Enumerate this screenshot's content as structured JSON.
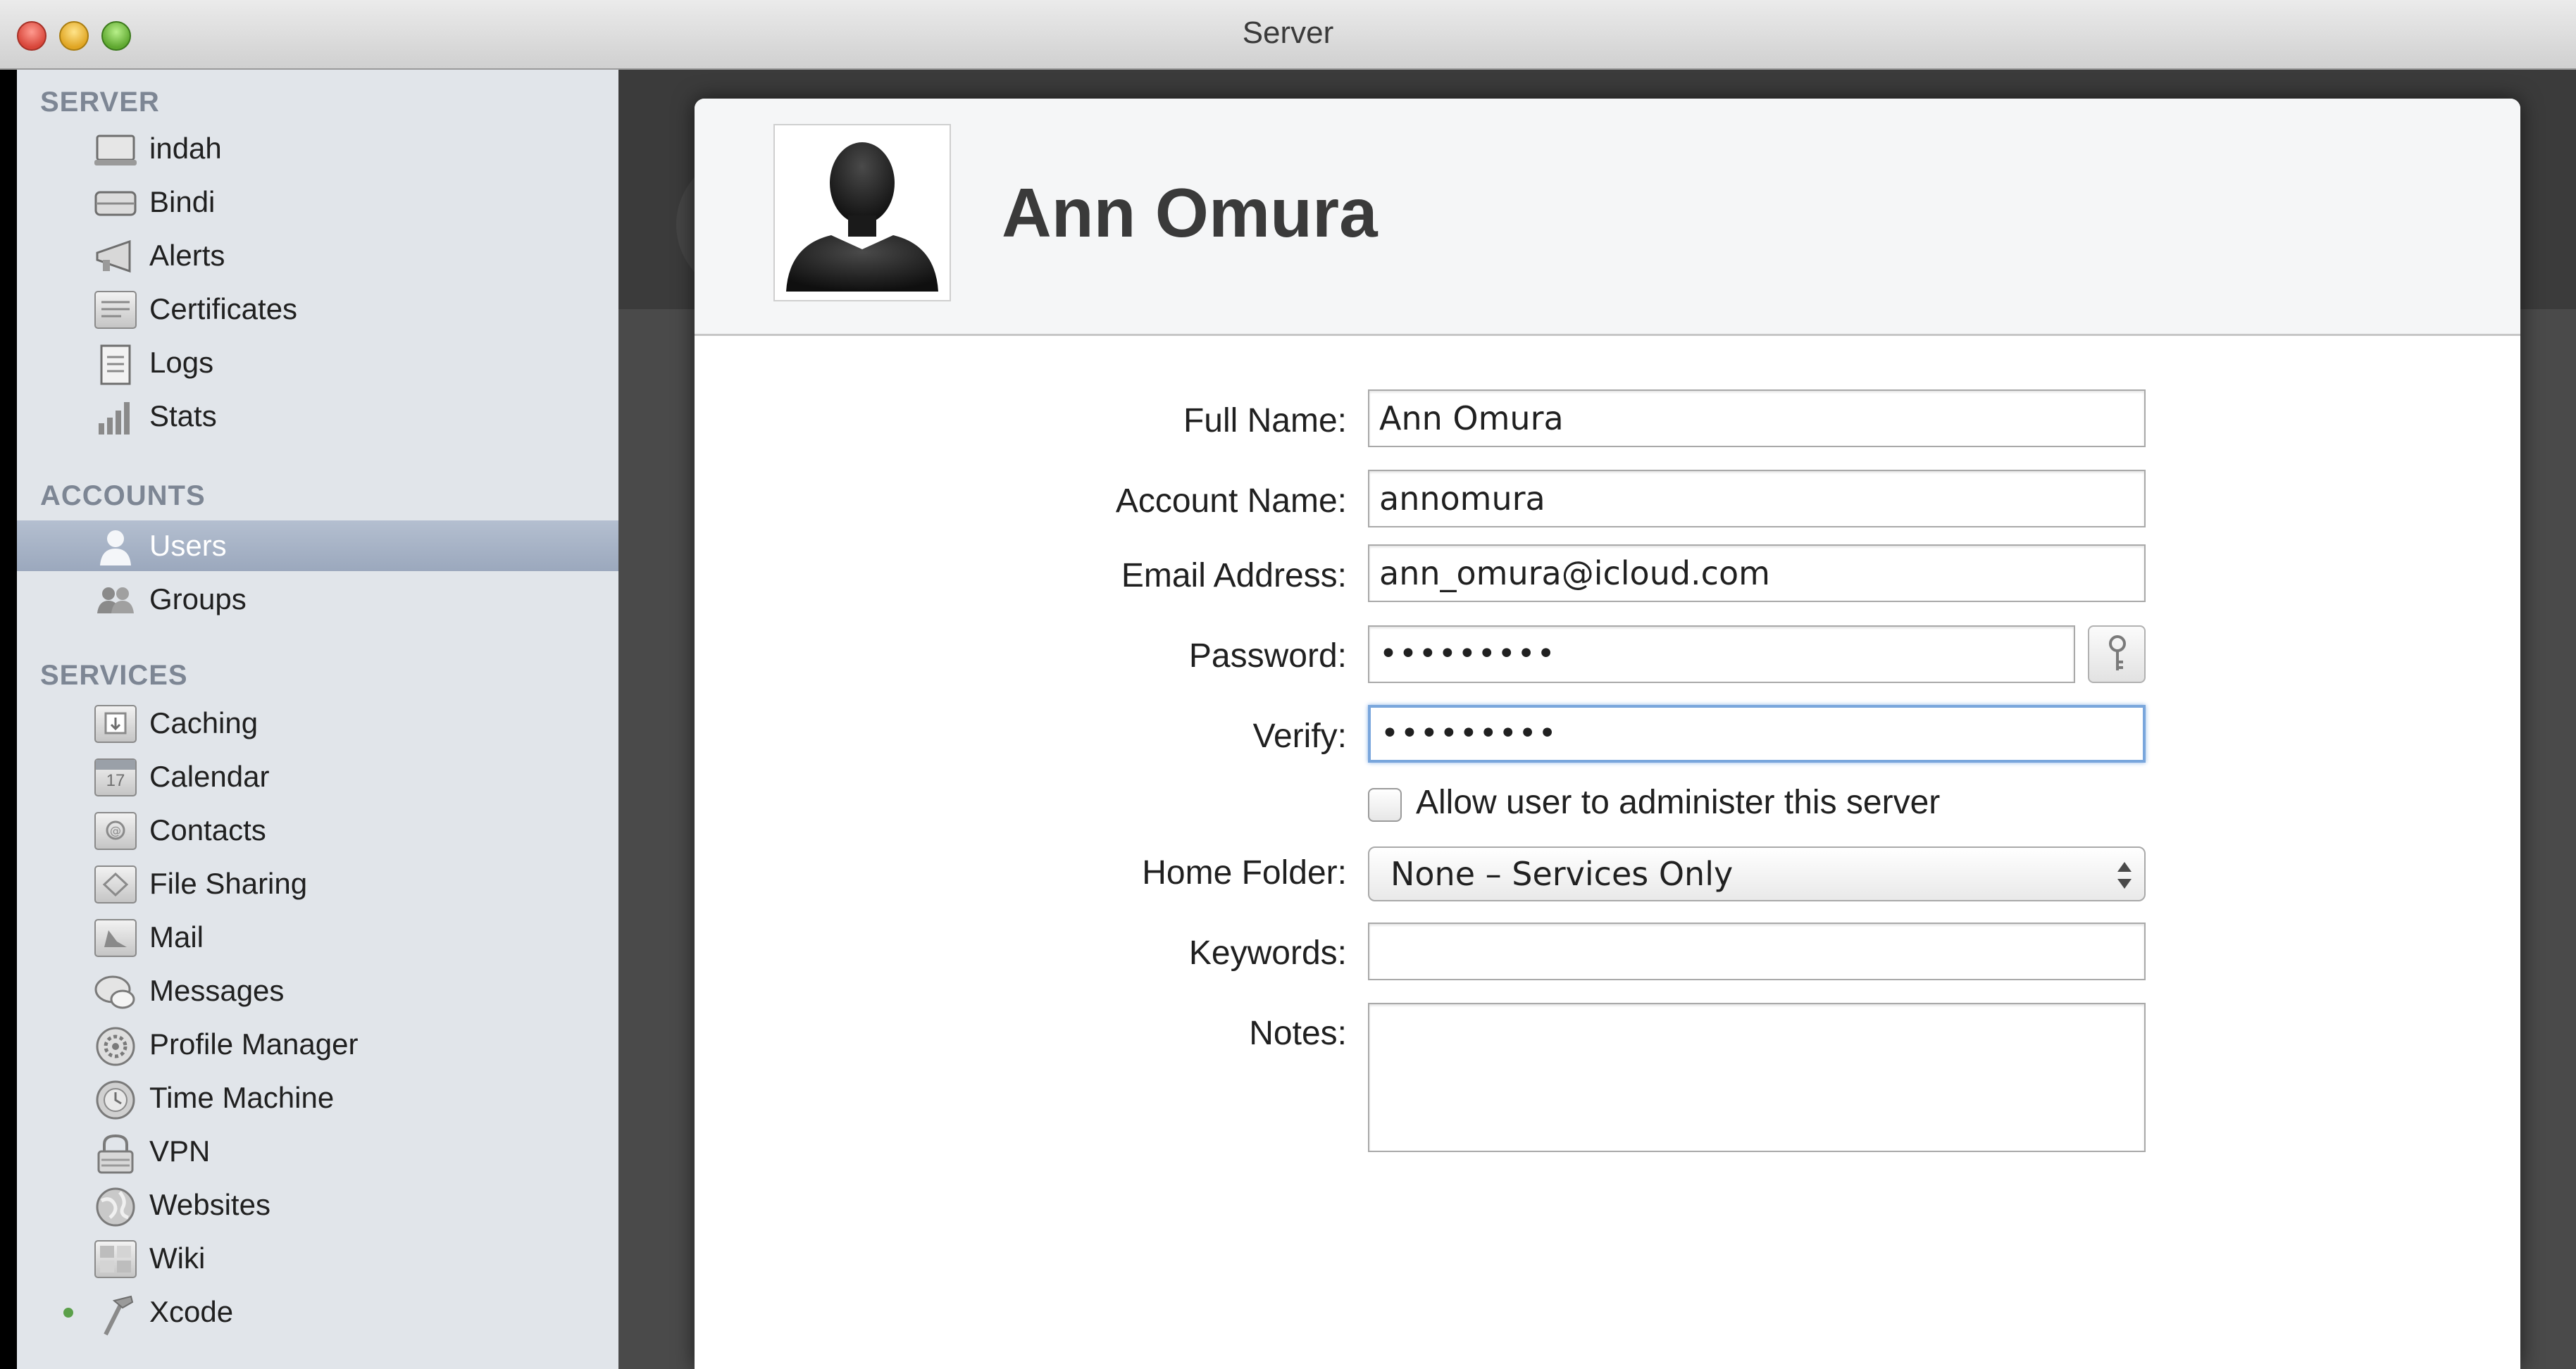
{
  "window": {
    "title": "Server"
  },
  "sidebar": {
    "server_heading": "SERVER",
    "server_items": [
      {
        "label": "indah",
        "icon": "computer-icon"
      },
      {
        "label": "Bindi",
        "icon": "drive-icon"
      },
      {
        "label": "Alerts",
        "icon": "megaphone-icon"
      },
      {
        "label": "Certificates",
        "icon": "certificate-icon"
      },
      {
        "label": "Logs",
        "icon": "document-icon"
      },
      {
        "label": "Stats",
        "icon": "bar-chart-icon"
      }
    ],
    "accounts_heading": "ACCOUNTS",
    "account_items": [
      {
        "label": "Users",
        "icon": "user-icon",
        "selected": true
      },
      {
        "label": "Groups",
        "icon": "group-icon"
      }
    ],
    "services_heading": "SERVICES",
    "service_items": [
      {
        "label": "Caching",
        "icon": "caching-icon"
      },
      {
        "label": "Calendar",
        "icon": "calendar-icon",
        "calendar_day": "17"
      },
      {
        "label": "Contacts",
        "icon": "contacts-icon"
      },
      {
        "label": "File Sharing",
        "icon": "folder-icon"
      },
      {
        "label": "Mail",
        "icon": "mail-icon"
      },
      {
        "label": "Messages",
        "icon": "chat-bubbles-icon"
      },
      {
        "label": "Profile Manager",
        "icon": "gear-icon"
      },
      {
        "label": "Time Machine",
        "icon": "clock-icon"
      },
      {
        "label": "VPN",
        "icon": "lock-icon"
      },
      {
        "label": "Websites",
        "icon": "globe-icon"
      },
      {
        "label": "Wiki",
        "icon": "wiki-icon"
      },
      {
        "label": "Xcode",
        "icon": "hammer-icon",
        "running": true
      }
    ],
    "colors": {
      "selected_bg": "#9ba8bd",
      "running_dot": "#5ba04a"
    }
  },
  "user": {
    "display_name": "Ann Omura",
    "labels": {
      "full_name": "Full Name:",
      "account_name": "Account Name:",
      "email": "Email Address:",
      "password": "Password:",
      "verify": "Verify:",
      "home_folder": "Home Folder:",
      "keywords": "Keywords:",
      "notes": "Notes:"
    },
    "full_name": "Ann Omura",
    "account_name": "annomura",
    "email": "ann_omura@icloud.com",
    "password_mask": "•••••••••",
    "verify_mask": "•••••••••",
    "allow_admin_label": "Allow user to administer this server",
    "allow_admin_checked": false,
    "home_folder": "None – Services Only",
    "keywords": "",
    "notes": ""
  }
}
